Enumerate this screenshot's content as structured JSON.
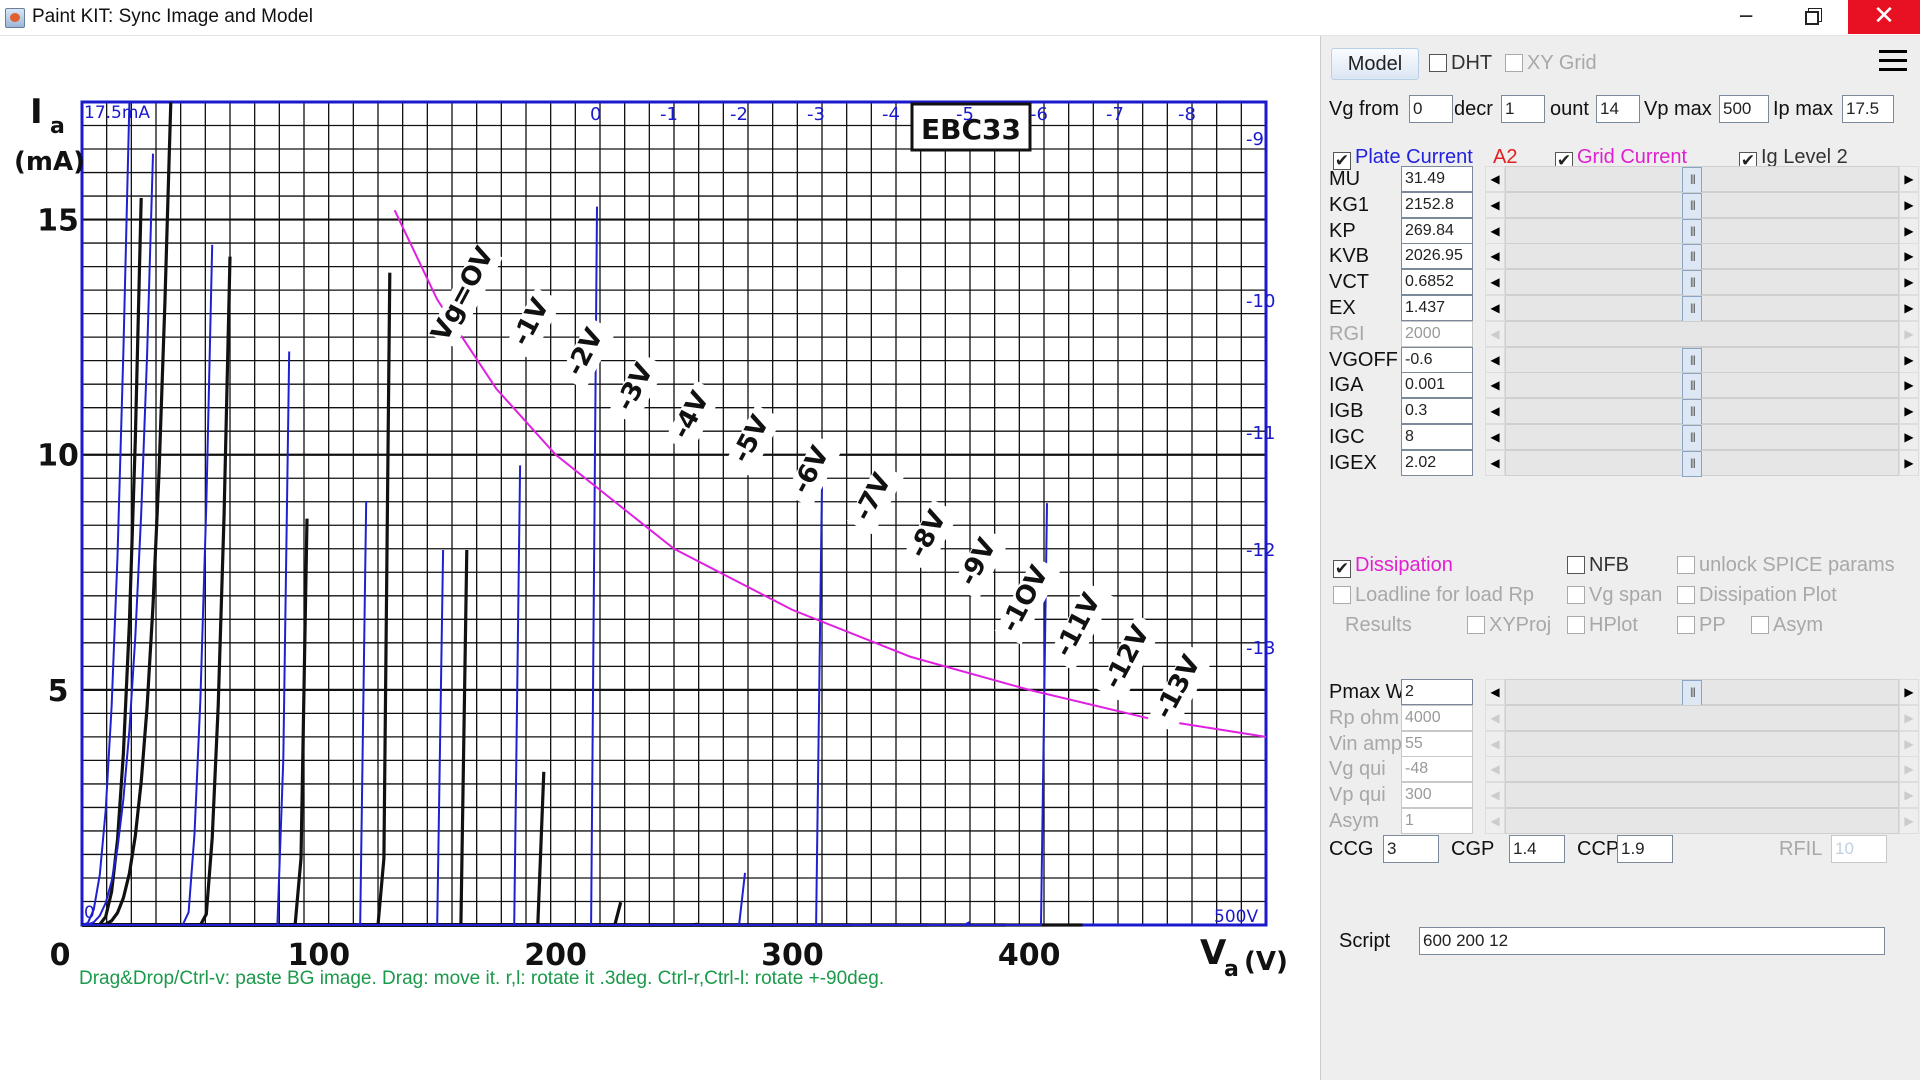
{
  "window": {
    "title": "Paint KIT: Sync Image and Model",
    "min": "─",
    "close": "✕"
  },
  "chart_data": {
    "type": "line",
    "title": "EBC33",
    "xlabel": "V",
    "xlabel_sub": "a",
    "xlabel_unit": "(V)",
    "ylabel": "I",
    "ylabel_sub": "a",
    "ylabel_unit": "(mA)",
    "xlim": [
      0,
      500
    ],
    "ylim": [
      0,
      17.5
    ],
    "x_ticks": [
      "0",
      "100",
      "200",
      "300",
      "400"
    ],
    "y_ticks": [
      "5",
      "10",
      "15"
    ],
    "corner_labels": {
      "top_left": "17.5mA",
      "bottom_left": "0",
      "bottom_right": "500V"
    },
    "curve_labels": [
      "Vg=OV",
      "-1V",
      "-2V",
      "-3V",
      "-4V",
      "-5V",
      "-6V",
      "-7V",
      "-8V",
      "-9V",
      "-1OV",
      "-11V",
      "-12V",
      "-13V"
    ],
    "model_top_labels": [
      "0",
      "-1",
      "-2",
      "-3",
      "-4",
      "-5",
      "-6",
      "-7",
      "-8"
    ],
    "model_right_labels": [
      "-9",
      "-10",
      "-11",
      "-12",
      "-13"
    ],
    "model": {
      "mu": 31.49,
      "kg1": 2152.8,
      "kp": 269.84,
      "kvb": 2026.95,
      "vct": 0.6852,
      "ex": 1.437,
      "vgs": [
        0,
        -1,
        -2,
        -3,
        -4,
        -5,
        -6,
        -7,
        -8,
        -9,
        -10,
        -11,
        -12,
        -13
      ]
    },
    "dissipation": {
      "pmax_w": 2,
      "points": [
        [
          132,
          15.2
        ],
        [
          150,
          13.3
        ],
        [
          175,
          11.4
        ],
        [
          200,
          10.0
        ],
        [
          250,
          8.0
        ],
        [
          300,
          6.7
        ],
        [
          350,
          5.7
        ],
        [
          400,
          5.0
        ],
        [
          450,
          4.4
        ],
        [
          500,
          4.0
        ]
      ]
    },
    "colors": {
      "model": "#2020d0",
      "bg_curves": "#111111",
      "dissipation": "#e020e0",
      "grid": "#111111",
      "frame": "#1a1acc"
    }
  },
  "hint": "Drag&Drop/Ctrl-v: paste BG image. Drag: move it. r,l: rotate it .3deg. Ctrl-r,Ctrl-l: rotate +-90deg.",
  "panel": {
    "model_button": "Model",
    "dht": "DHT",
    "xy_grid": "XY Grid",
    "vg_from_label": "Vg from",
    "vg_from": "0",
    "decr_label": "decr",
    "decr": "1",
    "count_label": "ount",
    "count": "14",
    "vpmax_label": "Vp max",
    "vpmax": "500",
    "ipmax_label": "Ip max",
    "ipmax": "17.5",
    "plate_current": "Plate Current",
    "a2": "A2",
    "grid_current": "Grid Current",
    "ig_level": "Ig Level 2",
    "params": [
      {
        "name": "MU",
        "value": "31.49",
        "enabled": true
      },
      {
        "name": "KG1",
        "value": "2152.8",
        "enabled": true
      },
      {
        "name": "KP",
        "value": "269.84",
        "enabled": true
      },
      {
        "name": "KVB",
        "value": "2026.95",
        "enabled": true
      },
      {
        "name": "VCT",
        "value": "0.6852",
        "enabled": true
      },
      {
        "name": "EX",
        "value": "1.437",
        "enabled": true
      },
      {
        "name": "RGI",
        "value": "2000",
        "enabled": false
      },
      {
        "name": "VGOFF",
        "value": "-0.6",
        "enabled": true
      },
      {
        "name": "IGA",
        "value": "0.001",
        "enabled": true
      },
      {
        "name": "IGB",
        "value": "0.3",
        "enabled": true
      },
      {
        "name": "IGC",
        "value": "8",
        "enabled": true
      },
      {
        "name": "IGEX",
        "value": "2.02",
        "enabled": true
      }
    ],
    "dissipation": "Dissipation",
    "nfb": "NFB",
    "unlock": "unlock SPICE params",
    "loadline": "Loadline for load Rp",
    "vg_span": "Vg span",
    "dissipation_plot": "Dissipation Plot",
    "results": "Results",
    "xyproj": "XYProj",
    "hplot": "HPlot",
    "pp": "PP",
    "asym_cb": "Asym",
    "params2": [
      {
        "name": "Pmax W",
        "value": "2",
        "enabled": true
      },
      {
        "name": "Rp ohm",
        "value": "4000",
        "enabled": false
      },
      {
        "name": "Vin ampl",
        "value": "55",
        "enabled": false
      },
      {
        "name": "Vg qui",
        "value": "-48",
        "enabled": false
      },
      {
        "name": "Vp qui",
        "value": "300",
        "enabled": false
      },
      {
        "name": "Asym",
        "value": "1",
        "enabled": false
      }
    ],
    "ccg_label": "CCG",
    "ccg": "3",
    "cgp_label": "CGP",
    "cgp": "1.4",
    "ccp_label": "CCP",
    "ccp": "1.9",
    "rfil_label": "RFIL",
    "rfil": "10",
    "script_label": "Script",
    "script": "600 200 12",
    "check": "✔"
  }
}
